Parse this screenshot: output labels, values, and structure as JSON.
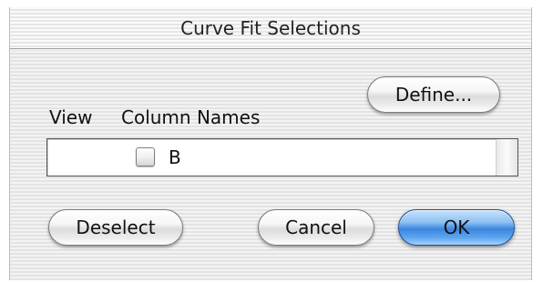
{
  "dialog": {
    "title": "Curve Fit Selections"
  },
  "buttons": {
    "define_label": "Define...",
    "deselect_label": "Deselect",
    "cancel_label": "Cancel",
    "ok_label": "OK"
  },
  "list": {
    "headers": {
      "view": "View",
      "column_names": "Column Names"
    },
    "items": [
      {
        "label": "B",
        "checked": false
      }
    ]
  },
  "colors": {
    "primary_button": "#3b86de",
    "dialog_background": "#ececec"
  }
}
